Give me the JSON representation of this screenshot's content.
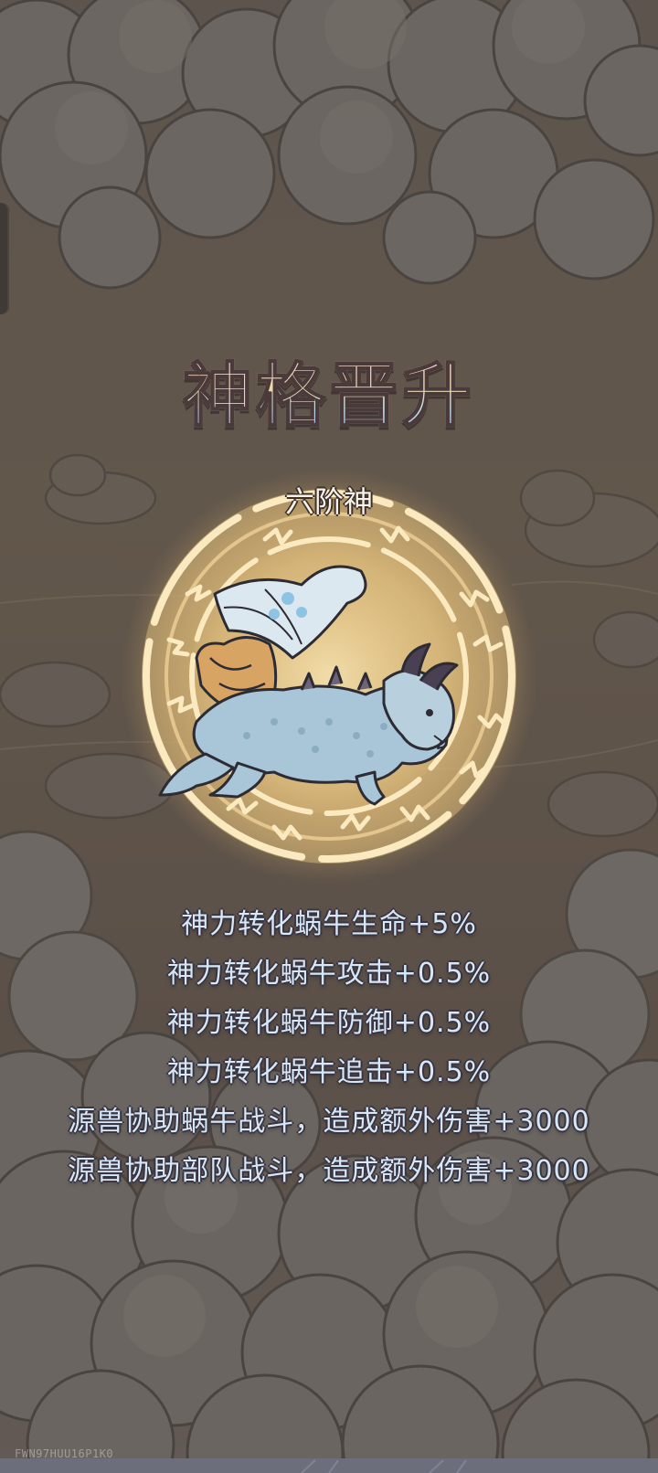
{
  "title": "神格晋升",
  "rank_label": "六阶神",
  "stats": [
    "神力转化蜗牛生命+5%",
    "神力转化蜗牛攻击+0.5%",
    "神力转化蜗牛防御+0.5%",
    "神力转化蜗牛追击+0.5%",
    "源兽协助蜗牛战斗，造成额外伤害+3000",
    "源兽协助部队战斗，造成额外伤害+3000"
  ],
  "watermark": "FWN97HUU16P1K0",
  "colors": {
    "background": "#5e5348",
    "cloud": "#6b6561",
    "glow": "#f4d48a",
    "ring": "#fbe9bf",
    "dragon": "#b9cfdd",
    "stat_text": "#d6e8f7"
  },
  "icons": {
    "emblem": "dragon-emblem",
    "ring": "rune-circle"
  }
}
